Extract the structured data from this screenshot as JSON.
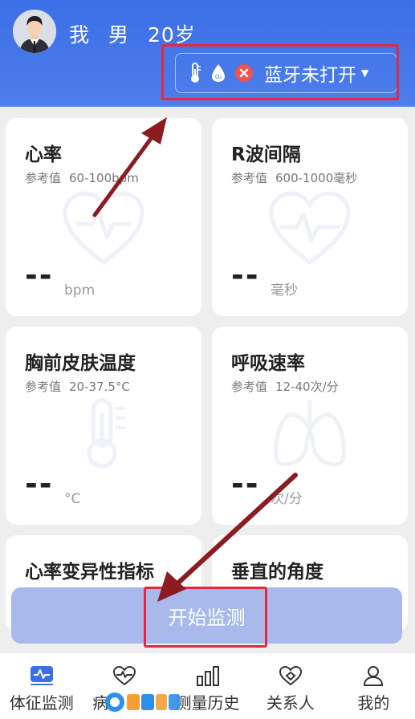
{
  "user": {
    "name": "我",
    "gender": "男",
    "age": "20岁"
  },
  "device": {
    "bluetooth_status": "蓝牙未打开",
    "icons": [
      "thermometer-icon",
      "oxygen-drop-icon",
      "error-x-icon",
      "caret-down-icon"
    ]
  },
  "cards": [
    {
      "title": "心率",
      "ref_label": "参考值",
      "ref_value": "60-100bpm",
      "value": "--",
      "unit": "bpm",
      "icon": "heart-pulse-icon"
    },
    {
      "title": "R波间隔",
      "ref_label": "参考值",
      "ref_value": "600-1000毫秒",
      "value": "--",
      "unit": "毫秒",
      "icon": "heart-ecg-icon"
    },
    {
      "title": "胸前皮肤温度",
      "ref_label": "参考值",
      "ref_value": "20-37.5°C",
      "value": "--",
      "unit": "°C",
      "icon": "thermometer-icon"
    },
    {
      "title": "呼吸速率",
      "ref_label": "参考值",
      "ref_value": "12-40次/分",
      "value": "--",
      "unit": "次/分",
      "icon": "lungs-icon"
    },
    {
      "title": "心率变异性指标",
      "icon": ""
    },
    {
      "title": "垂直的角度",
      "icon": ""
    }
  ],
  "start_button": {
    "label": "开始监测"
  },
  "tabs": [
    {
      "label": "体征监测",
      "icon": "vitals-icon",
      "active": true
    },
    {
      "label": "病",
      "icon": "heart-icon",
      "active": false
    },
    {
      "label": "测量历史",
      "icon": "bar-chart-icon",
      "active": false
    },
    {
      "label": "关系人",
      "icon": "heart-link-icon",
      "active": false
    },
    {
      "label": "我的",
      "icon": "person-icon",
      "active": false
    }
  ],
  "colors": {
    "header": "#4477e8",
    "start_button": "#a9b9ec",
    "highlight": "#e2293f",
    "arrow": "#8a1c22"
  }
}
